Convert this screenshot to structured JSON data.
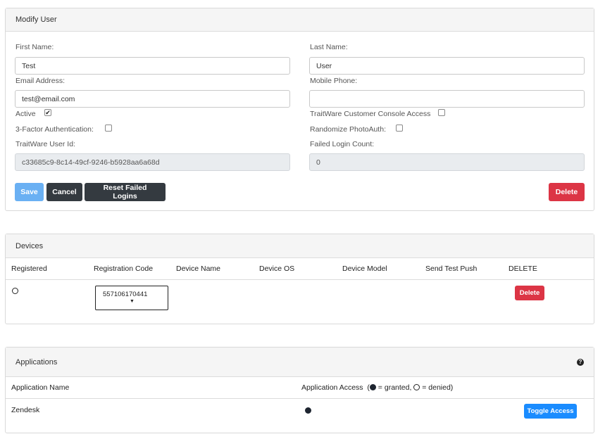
{
  "modify_user": {
    "title": "Modify User",
    "first_name": {
      "label": "First Name:",
      "value": "Test"
    },
    "last_name": {
      "label": "Last Name:",
      "value": "User"
    },
    "email": {
      "label": "Email Address:",
      "value": "test@email.com"
    },
    "mobile_phone": {
      "label": "Mobile Phone:",
      "value": ""
    },
    "active": {
      "label": "Active",
      "checked": true
    },
    "console_access": {
      "label": "TraitWare Customer Console Access",
      "checked": false
    },
    "three_factor": {
      "label": "3-Factor Authentication:",
      "checked": false
    },
    "randomize_photo": {
      "label": "Randomize PhotoAuth:",
      "checked": false
    },
    "user_id": {
      "label": "TraitWare User Id:",
      "value": "c33685c9-8c14-49cf-9246-b5928aa6a68d"
    },
    "failed_login": {
      "label": "Failed Login Count:",
      "value": "0"
    },
    "buttons": {
      "save": "Save",
      "cancel": "Cancel",
      "reset": "Reset Failed Logins",
      "delete": "Delete"
    }
  },
  "devices": {
    "title": "Devices",
    "columns": [
      "Registered",
      "Registration Code",
      "Device Name",
      "Device OS",
      "Device Model",
      "Send Test Push",
      "DELETE"
    ],
    "rows": [
      {
        "registered": false,
        "registration_code": "557106170441",
        "device_name": "",
        "device_os": "",
        "device_model": "",
        "delete_label": "Delete"
      }
    ]
  },
  "applications": {
    "title": "Applications",
    "columns": {
      "name": "Application Name",
      "access_prefix": "Application Access  (",
      "granted": " = granted, ",
      "denied": " = denied)"
    },
    "rows": [
      {
        "name": "Zendesk",
        "granted": true,
        "toggle_label": "Toggle Access"
      }
    ]
  },
  "colors": {
    "save": "#6ab0f3",
    "dark": "#343a40",
    "danger": "#dc3545",
    "primary": "#1a8cff"
  }
}
